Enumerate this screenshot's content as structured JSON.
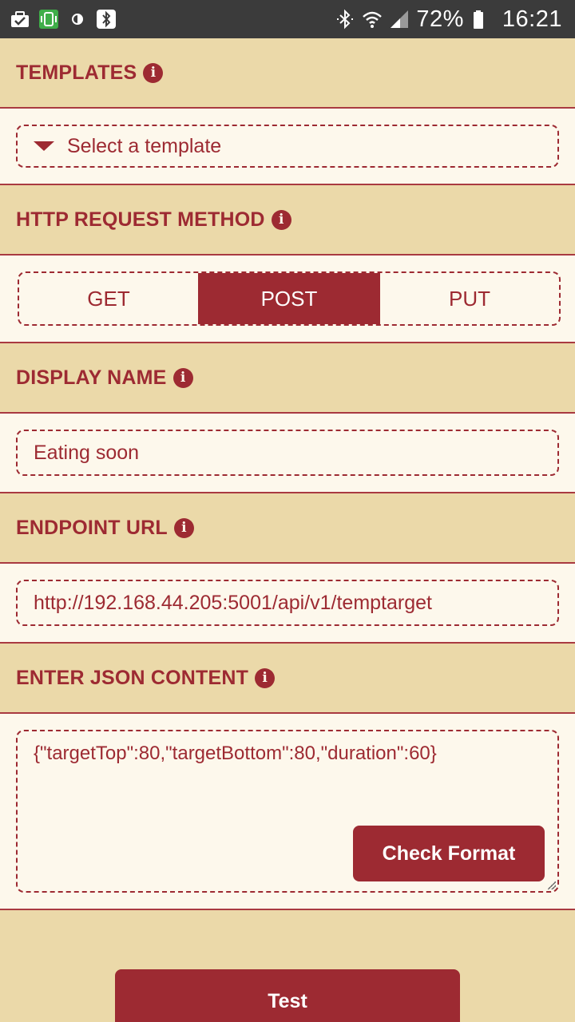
{
  "status_bar": {
    "left_icons": [
      "briefcase-icon",
      "screen-mirror-icon",
      "contrast-icon",
      "bluetooth-icon"
    ],
    "right_icons": [
      "bluetooth-icon",
      "wifi-icon",
      "signal-icon",
      "battery-icon"
    ],
    "battery_percent": "72%",
    "clock": "16:21"
  },
  "sections": {
    "templates": {
      "title": "TEMPLATES",
      "select_label": "Select a template"
    },
    "http_method": {
      "title": "HTTP REQUEST METHOD",
      "options": [
        "GET",
        "POST",
        "PUT"
      ],
      "selected": "POST"
    },
    "display_name": {
      "title": "DISPLAY NAME",
      "value": "Eating soon"
    },
    "endpoint_url": {
      "title": "ENDPOINT URL",
      "value": "http://192.168.44.205:5001/api/v1/temptarget"
    },
    "json_content": {
      "title": "ENTER JSON CONTENT",
      "value": "{\"targetTop\":80,\"targetBottom\":80,\"duration\":60}",
      "check_button": "Check Format"
    }
  },
  "test_button": "Test",
  "colors": {
    "accent": "#9d2a32",
    "header_bg": "#ebd9a9",
    "panel_bg": "#fdf8ec",
    "status_bar": "#3b3b3b"
  }
}
